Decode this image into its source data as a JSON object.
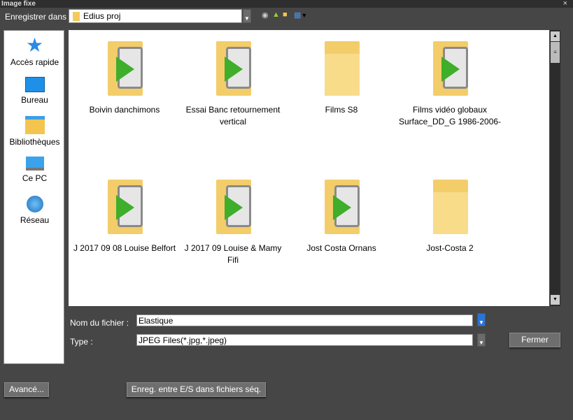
{
  "window": {
    "title": "Image fixe",
    "close": "×"
  },
  "save_in": {
    "label": "Enregistrer dans :",
    "value": "Edius proj"
  },
  "toolbar": [
    "back-icon",
    "up-folder-icon",
    "new-folder-icon",
    "view-menu-icon"
  ],
  "places": [
    {
      "label": "Accès rapide",
      "icon": "star-icon"
    },
    {
      "label": "Bureau",
      "icon": "desktop-icon"
    },
    {
      "label": "Bibliothèques",
      "icon": "libraries-icon"
    },
    {
      "label": "Ce PC",
      "icon": "computer-icon"
    },
    {
      "label": "Réseau",
      "icon": "network-icon"
    }
  ],
  "items": [
    {
      "name": "Boivin danchimons",
      "type": "project"
    },
    {
      "name": "Essai Banc retournement vertical",
      "type": "project"
    },
    {
      "name": "Films S8",
      "type": "folder"
    },
    {
      "name": "Films vidéo globaux Surface_DD_G 1986-2006-",
      "type": "project"
    },
    {
      "name": "J 2017 09 08 Louise Belfort",
      "type": "project"
    },
    {
      "name": "J 2017 09 Louise & Mamy Fifi",
      "type": "project"
    },
    {
      "name": "Jost Costa Ornans",
      "type": "project"
    },
    {
      "name": "Jost-Costa 2",
      "type": "folder"
    }
  ],
  "filename": {
    "label": "Nom du fichier :",
    "value": "Elastique"
  },
  "type": {
    "label": "Type :",
    "value": "JPEG Files(*.jpg,*.jpeg)"
  },
  "buttons": {
    "close": "Fermer",
    "advanced": "Avancé...",
    "seq": "Enreg. entre E/S dans fichiers séq."
  }
}
